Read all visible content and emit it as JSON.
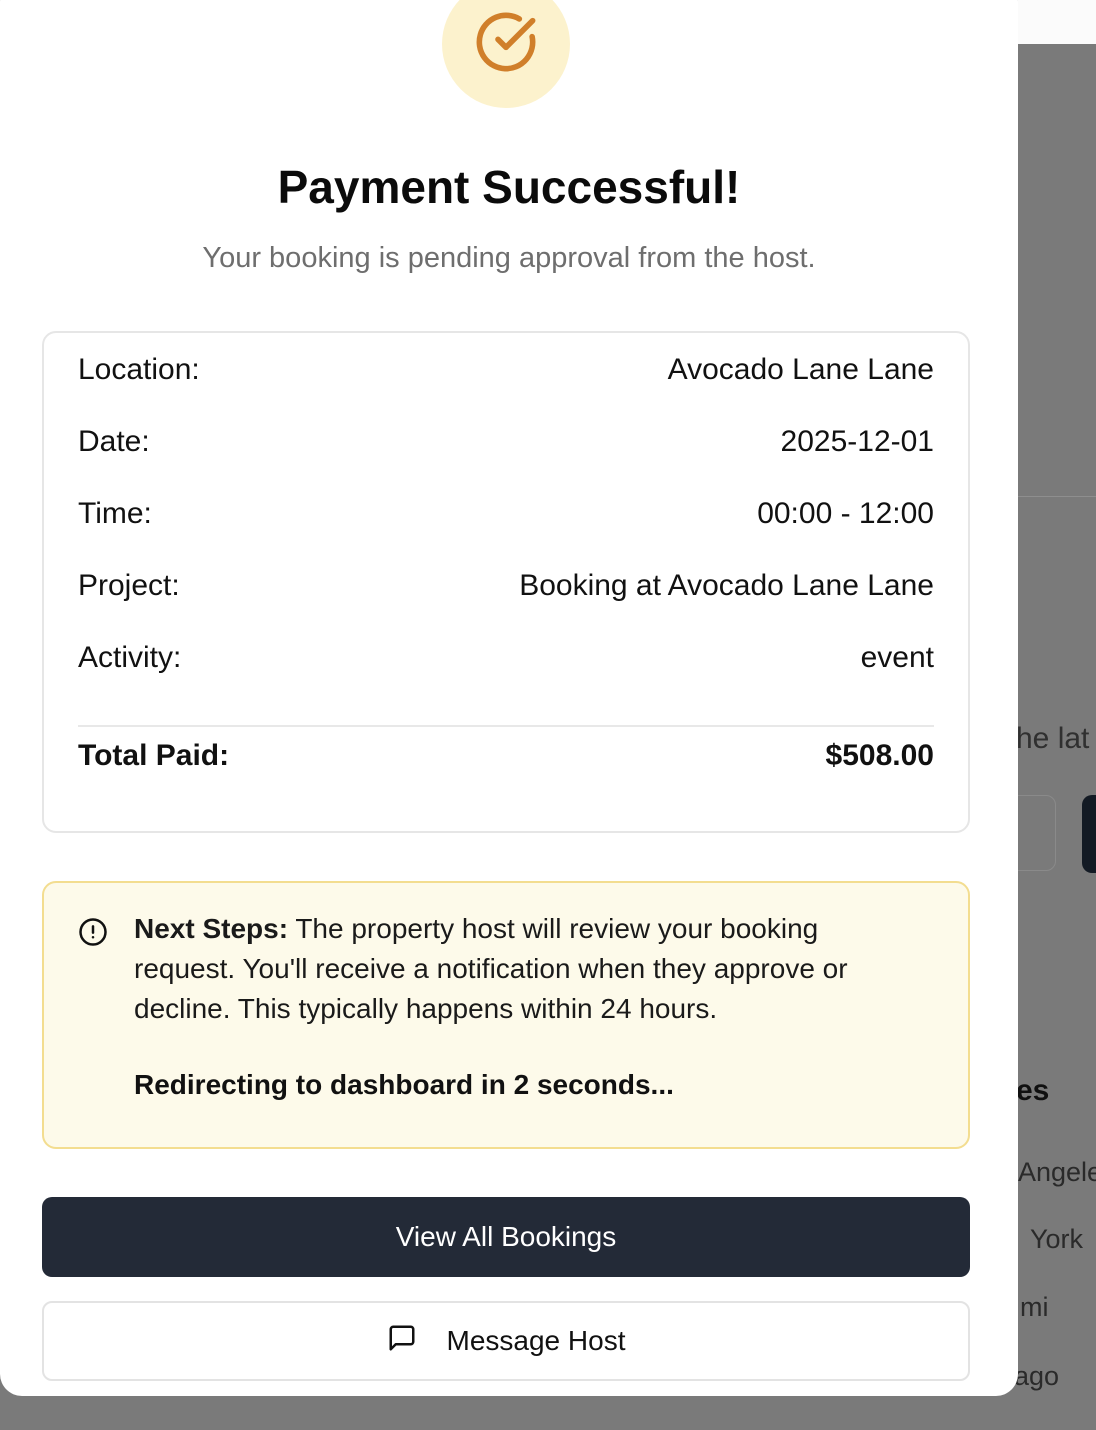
{
  "modal": {
    "title": "Payment Successful!",
    "subtitle": "Your booking is pending approval from the host.",
    "details": {
      "location_label": "Location:",
      "location_value": "Avocado Lane Lane",
      "date_label": "Date:",
      "date_value": "2025-12-01",
      "time_label": "Time:",
      "time_value": "00:00 - 12:00",
      "project_label": "Project:",
      "project_value": "Booking at Avocado Lane Lane",
      "activity_label": "Activity:",
      "activity_value": "event",
      "total_label": "Total Paid:",
      "total_value": "$508.00"
    },
    "notice": {
      "heading": "Next Steps:",
      "body": "The property host will review your booking request. You'll receive a notification when they approve or decline. This typically happens within 24 hours.",
      "redirect": "Redirecting to dashboard in 2 seconds..."
    },
    "buttons": {
      "view_bookings": "View All Bookings",
      "message_host": "Message Host"
    },
    "icons": {
      "success": "check-circle-icon",
      "notice": "alert-circle-icon",
      "message": "message-square-icon"
    },
    "colors": {
      "success_icon": "#d07f2a",
      "success_bg": "#fcf2cd",
      "notice_bg": "#fdfaea",
      "notice_border": "#f3dd90",
      "primary_button": "#232a37"
    }
  },
  "background": {
    "partial_text_1": "he lat",
    "partial_heading": "es",
    "cities": [
      "Angele",
      "York",
      "mi",
      "ago"
    ]
  }
}
